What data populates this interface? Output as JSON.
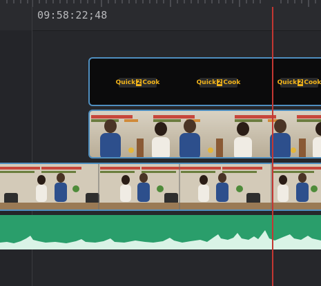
{
  "timeline": {
    "timecode": "09:58:22;48"
  },
  "title_clip": {
    "logo_text_left": "Quick",
    "logo_num": "2",
    "logo_text_right": "Cook"
  },
  "colors": {
    "clip_border": "#4f8fc0",
    "audio_fill": "#2a9e6b",
    "playhead": "#c43732",
    "logo_accent": "#f1b31a"
  }
}
